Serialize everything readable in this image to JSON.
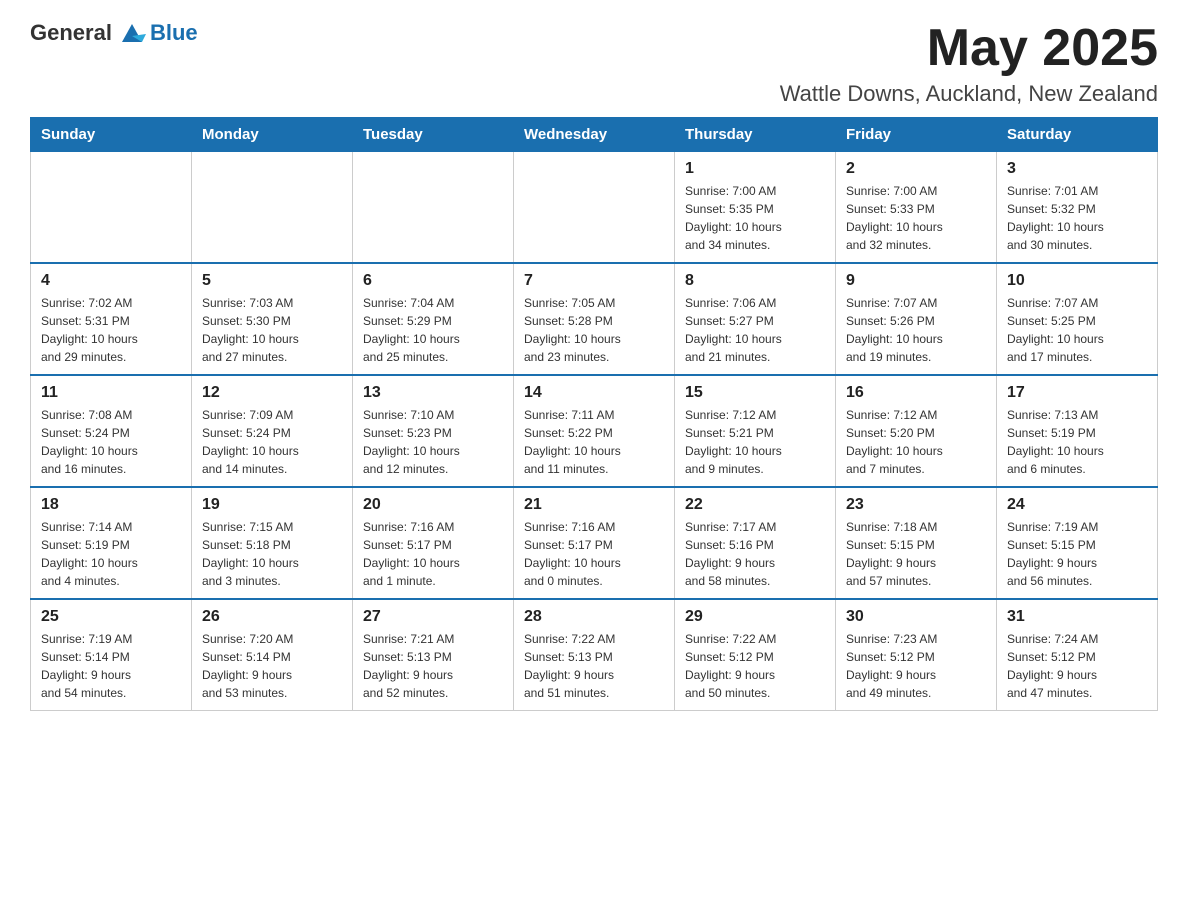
{
  "header": {
    "logo_general": "General",
    "logo_blue": "Blue",
    "month_title": "May 2025",
    "location": "Wattle Downs, Auckland, New Zealand"
  },
  "weekdays": [
    "Sunday",
    "Monday",
    "Tuesday",
    "Wednesday",
    "Thursday",
    "Friday",
    "Saturday"
  ],
  "weeks": [
    [
      {
        "day": "",
        "info": ""
      },
      {
        "day": "",
        "info": ""
      },
      {
        "day": "",
        "info": ""
      },
      {
        "day": "",
        "info": ""
      },
      {
        "day": "1",
        "info": "Sunrise: 7:00 AM\nSunset: 5:35 PM\nDaylight: 10 hours\nand 34 minutes."
      },
      {
        "day": "2",
        "info": "Sunrise: 7:00 AM\nSunset: 5:33 PM\nDaylight: 10 hours\nand 32 minutes."
      },
      {
        "day": "3",
        "info": "Sunrise: 7:01 AM\nSunset: 5:32 PM\nDaylight: 10 hours\nand 30 minutes."
      }
    ],
    [
      {
        "day": "4",
        "info": "Sunrise: 7:02 AM\nSunset: 5:31 PM\nDaylight: 10 hours\nand 29 minutes."
      },
      {
        "day": "5",
        "info": "Sunrise: 7:03 AM\nSunset: 5:30 PM\nDaylight: 10 hours\nand 27 minutes."
      },
      {
        "day": "6",
        "info": "Sunrise: 7:04 AM\nSunset: 5:29 PM\nDaylight: 10 hours\nand 25 minutes."
      },
      {
        "day": "7",
        "info": "Sunrise: 7:05 AM\nSunset: 5:28 PM\nDaylight: 10 hours\nand 23 minutes."
      },
      {
        "day": "8",
        "info": "Sunrise: 7:06 AM\nSunset: 5:27 PM\nDaylight: 10 hours\nand 21 minutes."
      },
      {
        "day": "9",
        "info": "Sunrise: 7:07 AM\nSunset: 5:26 PM\nDaylight: 10 hours\nand 19 minutes."
      },
      {
        "day": "10",
        "info": "Sunrise: 7:07 AM\nSunset: 5:25 PM\nDaylight: 10 hours\nand 17 minutes."
      }
    ],
    [
      {
        "day": "11",
        "info": "Sunrise: 7:08 AM\nSunset: 5:24 PM\nDaylight: 10 hours\nand 16 minutes."
      },
      {
        "day": "12",
        "info": "Sunrise: 7:09 AM\nSunset: 5:24 PM\nDaylight: 10 hours\nand 14 minutes."
      },
      {
        "day": "13",
        "info": "Sunrise: 7:10 AM\nSunset: 5:23 PM\nDaylight: 10 hours\nand 12 minutes."
      },
      {
        "day": "14",
        "info": "Sunrise: 7:11 AM\nSunset: 5:22 PM\nDaylight: 10 hours\nand 11 minutes."
      },
      {
        "day": "15",
        "info": "Sunrise: 7:12 AM\nSunset: 5:21 PM\nDaylight: 10 hours\nand 9 minutes."
      },
      {
        "day": "16",
        "info": "Sunrise: 7:12 AM\nSunset: 5:20 PM\nDaylight: 10 hours\nand 7 minutes."
      },
      {
        "day": "17",
        "info": "Sunrise: 7:13 AM\nSunset: 5:19 PM\nDaylight: 10 hours\nand 6 minutes."
      }
    ],
    [
      {
        "day": "18",
        "info": "Sunrise: 7:14 AM\nSunset: 5:19 PM\nDaylight: 10 hours\nand 4 minutes."
      },
      {
        "day": "19",
        "info": "Sunrise: 7:15 AM\nSunset: 5:18 PM\nDaylight: 10 hours\nand 3 minutes."
      },
      {
        "day": "20",
        "info": "Sunrise: 7:16 AM\nSunset: 5:17 PM\nDaylight: 10 hours\nand 1 minute."
      },
      {
        "day": "21",
        "info": "Sunrise: 7:16 AM\nSunset: 5:17 PM\nDaylight: 10 hours\nand 0 minutes."
      },
      {
        "day": "22",
        "info": "Sunrise: 7:17 AM\nSunset: 5:16 PM\nDaylight: 9 hours\nand 58 minutes."
      },
      {
        "day": "23",
        "info": "Sunrise: 7:18 AM\nSunset: 5:15 PM\nDaylight: 9 hours\nand 57 minutes."
      },
      {
        "day": "24",
        "info": "Sunrise: 7:19 AM\nSunset: 5:15 PM\nDaylight: 9 hours\nand 56 minutes."
      }
    ],
    [
      {
        "day": "25",
        "info": "Sunrise: 7:19 AM\nSunset: 5:14 PM\nDaylight: 9 hours\nand 54 minutes."
      },
      {
        "day": "26",
        "info": "Sunrise: 7:20 AM\nSunset: 5:14 PM\nDaylight: 9 hours\nand 53 minutes."
      },
      {
        "day": "27",
        "info": "Sunrise: 7:21 AM\nSunset: 5:13 PM\nDaylight: 9 hours\nand 52 minutes."
      },
      {
        "day": "28",
        "info": "Sunrise: 7:22 AM\nSunset: 5:13 PM\nDaylight: 9 hours\nand 51 minutes."
      },
      {
        "day": "29",
        "info": "Sunrise: 7:22 AM\nSunset: 5:12 PM\nDaylight: 9 hours\nand 50 minutes."
      },
      {
        "day": "30",
        "info": "Sunrise: 7:23 AM\nSunset: 5:12 PM\nDaylight: 9 hours\nand 49 minutes."
      },
      {
        "day": "31",
        "info": "Sunrise: 7:24 AM\nSunset: 5:12 PM\nDaylight: 9 hours\nand 47 minutes."
      }
    ]
  ]
}
